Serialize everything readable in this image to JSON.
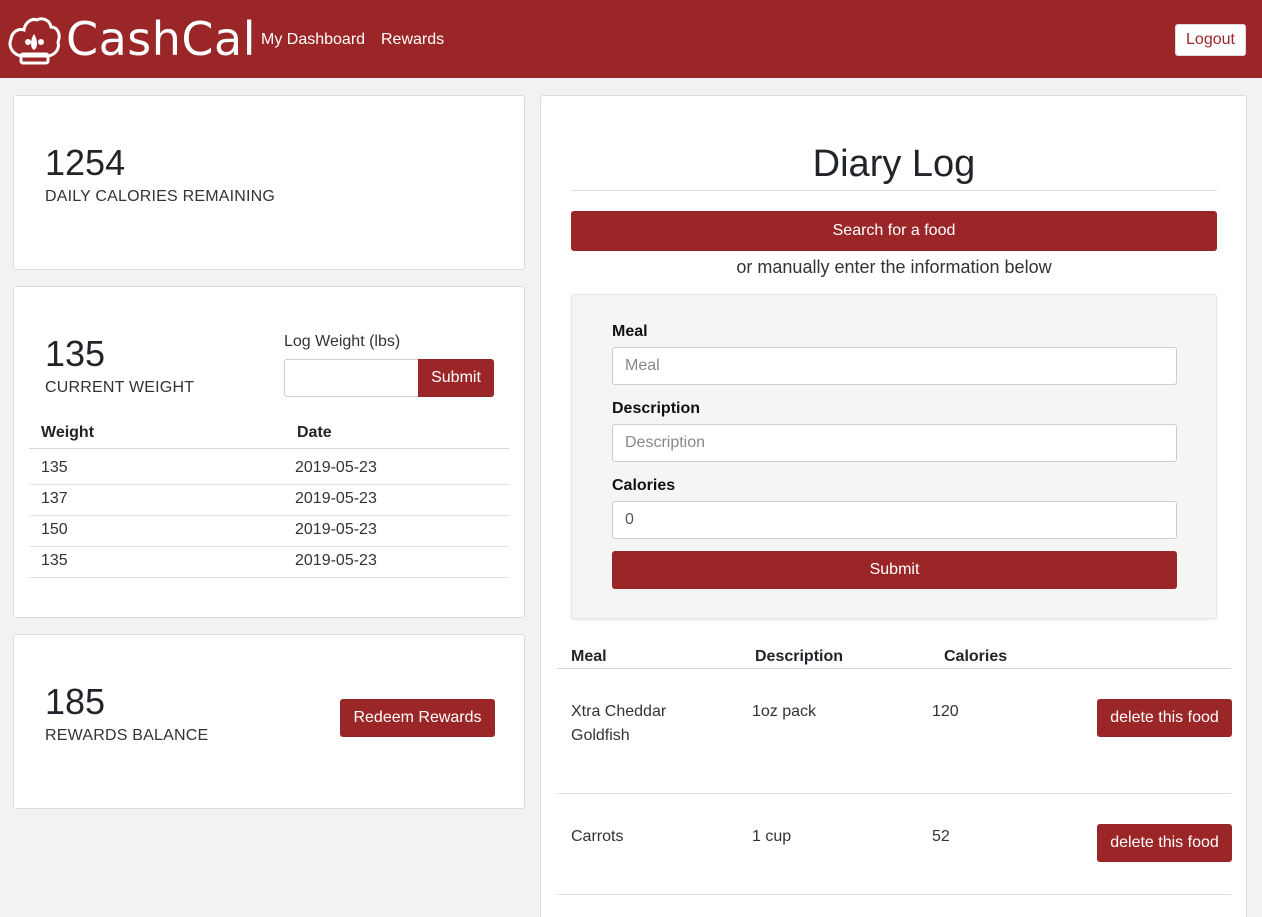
{
  "header": {
    "brand": "CashCal",
    "nav": [
      "My Dashboard",
      "Rewards"
    ],
    "logout_label": "Logout",
    "bar_color": "#9b2628"
  },
  "calories": {
    "value": "1254",
    "label": "DAILY CALORIES REMAINING"
  },
  "weight": {
    "value": "135",
    "label": "CURRENT WEIGHT",
    "log_label": "Log Weight (lbs)",
    "submit_label": "Submit",
    "table": {
      "headers": [
        "Weight",
        "Date"
      ],
      "rows": [
        [
          "135",
          "2019-05-23"
        ],
        [
          "137",
          "2019-05-23"
        ],
        [
          "150",
          "2019-05-23"
        ],
        [
          "135",
          "2019-05-23"
        ]
      ]
    }
  },
  "rewards": {
    "value": "185",
    "label": "REWARDS BALANCE",
    "redeem_label": "Redeem Rewards"
  },
  "diary": {
    "title": "Diary Log",
    "search_label": "Search for a food",
    "subtitle": "or manually enter the information below",
    "form": {
      "meal_label": "Meal",
      "meal_placeholder": "Meal",
      "description_label": "Description",
      "description_placeholder": "Description",
      "calories_label": "Calories",
      "calories_value": "0",
      "submit_label": "Submit"
    },
    "table": {
      "headers": [
        "Meal",
        "Description",
        "Calories"
      ],
      "delete_label": "delete this food",
      "rows": [
        {
          "meal": "Xtra Cheddar Goldfish",
          "description": "1oz pack",
          "calories": "120"
        },
        {
          "meal": "Carrots",
          "description": "1 cup",
          "calories": "52"
        }
      ]
    }
  }
}
